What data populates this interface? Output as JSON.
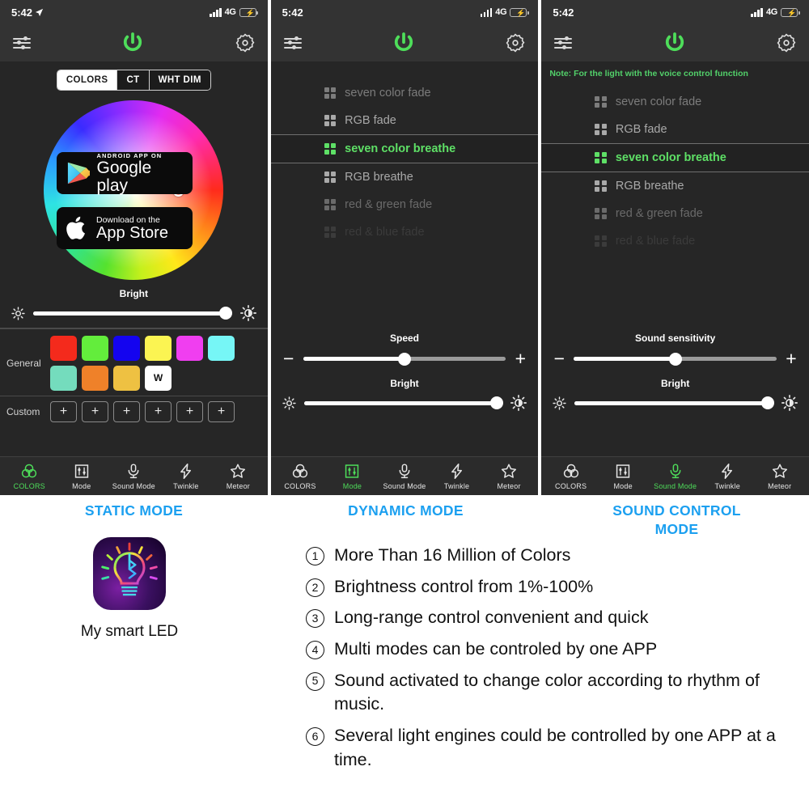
{
  "status_bar": {
    "time": "5:42",
    "network": "4G"
  },
  "header": {
    "sliders_icon": "sliders-icon",
    "power_icon": "power-icon",
    "gear_icon": "gear-icon",
    "power_color": "#4ede5a"
  },
  "panels": [
    {
      "id": "static",
      "caption": "STATIC MODE",
      "tabs": [
        {
          "label": "COLORS",
          "active": true
        },
        {
          "label": "CT",
          "active": false
        },
        {
          "label": "WHT DIM",
          "active": false
        }
      ],
      "sliders": [
        {
          "name": "Bright",
          "value": 97
        }
      ],
      "general_label": "General",
      "custom_label": "Custom",
      "general_colors_row1": [
        "#f42a1c",
        "#63ed3c",
        "#1404ef",
        "#fbf452",
        "#f03ef0",
        "#76f6f6"
      ],
      "general_colors_row2": [
        "#74dcbd",
        "#ef8129",
        "#eec142",
        "#ffffff"
      ],
      "white_label": "W",
      "custom_slots": [
        "+",
        "+",
        "+",
        "+",
        "+",
        "+"
      ],
      "nav": [
        {
          "label": "COLORS",
          "icon": "colors-icon",
          "active": true
        },
        {
          "label": "Mode",
          "icon": "mode-icon",
          "active": false
        },
        {
          "label": "Sound Mode",
          "icon": "microphone-icon",
          "active": false
        },
        {
          "label": "Twinkle",
          "icon": "bolt-icon",
          "active": false
        },
        {
          "label": "Meteor",
          "icon": "star-icon",
          "active": false
        }
      ]
    },
    {
      "id": "dynamic",
      "caption": "DYNAMIC MODE",
      "note": "",
      "modes": [
        {
          "label": "seven color fade",
          "active": false
        },
        {
          "label": "RGB fade",
          "active": false
        },
        {
          "label": "seven color breathe",
          "active": true
        },
        {
          "label": "RGB breathe",
          "active": false
        },
        {
          "label": "red & green fade",
          "active": false
        },
        {
          "label": "red & blue fade",
          "active": false
        }
      ],
      "sliders": [
        {
          "name": "Speed",
          "value": 50
        },
        {
          "name": "Bright",
          "value": 97
        }
      ],
      "nav": [
        {
          "label": "COLORS",
          "icon": "colors-icon",
          "active": false
        },
        {
          "label": "Mode",
          "icon": "mode-icon",
          "active": true
        },
        {
          "label": "Sound Mode",
          "icon": "microphone-icon",
          "active": false
        },
        {
          "label": "Twinkle",
          "icon": "bolt-icon",
          "active": false
        },
        {
          "label": "Meteor",
          "icon": "star-icon",
          "active": false
        }
      ]
    },
    {
      "id": "sound",
      "caption": "SOUND CONTROL MODE",
      "note": "Note: For the light with the voice control function",
      "modes": [
        {
          "label": "seven color fade",
          "active": false
        },
        {
          "label": "RGB fade",
          "active": false
        },
        {
          "label": "seven color breathe",
          "active": true
        },
        {
          "label": "RGB breathe",
          "active": false
        },
        {
          "label": "red & green fade",
          "active": false
        },
        {
          "label": "red & blue fade",
          "active": false
        }
      ],
      "sliders": [
        {
          "name": "Sound sensitivity",
          "value": 50
        },
        {
          "name": "Bright",
          "value": 97
        }
      ],
      "nav": [
        {
          "label": "COLORS",
          "icon": "colors-icon",
          "active": false
        },
        {
          "label": "Mode",
          "icon": "mode-icon",
          "active": false
        },
        {
          "label": "Sound Mode",
          "icon": "microphone-icon",
          "active": true
        },
        {
          "label": "Twinkle",
          "icon": "bolt-icon",
          "active": false
        },
        {
          "label": "Meteor",
          "icon": "star-icon",
          "active": false
        }
      ]
    }
  ],
  "app": {
    "icon_name": "smart-led-bulb-bluetooth-icon",
    "name": "My smart LED",
    "google_play": {
      "small": "ANDROID APP ON",
      "large": "Google play"
    },
    "app_store": {
      "small": "Download on the",
      "large": "App Store"
    }
  },
  "features": [
    {
      "num": "①",
      "text": "More Than 16 Million of Colors"
    },
    {
      "num": "②",
      "text": "Brightness control from 1%-100%"
    },
    {
      "num": "③",
      "text": "Long-range control convenient and quick"
    },
    {
      "num": "④",
      "text": "Multi modes can be controled by one APP"
    },
    {
      "num": "⑤",
      "text": "Sound activated to change color according to rhythm of music."
    },
    {
      "num": "⑥",
      "text": "Several light engines could be controlled by one APP at a time."
    }
  ],
  "colors": {
    "accent_green": "#4ede5a",
    "caption_blue": "#1ca0f0"
  }
}
